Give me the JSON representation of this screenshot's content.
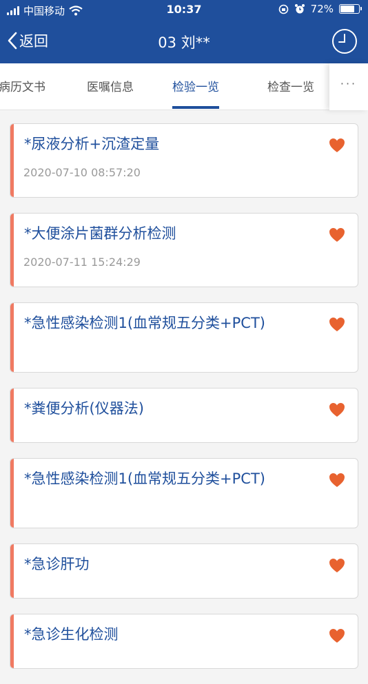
{
  "status_bar": {
    "carrier": "中国移动",
    "time": "10:37",
    "battery": "72%",
    "battery_level": 0.72
  },
  "nav": {
    "back_label": "返回",
    "title": "03 刘**"
  },
  "tabs": [
    {
      "label": "病历文书",
      "active": false
    },
    {
      "label": "医嘱信息",
      "active": false
    },
    {
      "label": "检验一览",
      "active": true
    },
    {
      "label": "检查一览",
      "active": false
    }
  ],
  "more_label": "···",
  "items": [
    {
      "name": "*尿液分析+沉渣定量",
      "date": "2020-07-10 08:57:20"
    },
    {
      "name": "*大便涂片菌群分析检测",
      "date": "2020-07-11 15:24:29"
    },
    {
      "name": "*急性感染检测1(血常规五分类+PCT)",
      "date": ""
    },
    {
      "name": "*粪便分析(仪器法)",
      "date": ""
    },
    {
      "name": "*急性感染检测1(血常规五分类+PCT)",
      "date": ""
    },
    {
      "name": "*急诊肝功",
      "date": ""
    },
    {
      "name": "*急诊生化检测",
      "date": ""
    }
  ],
  "colors": {
    "primary": "#1f4f9c",
    "accent": "#f07a62",
    "heart": "#e8622f"
  }
}
